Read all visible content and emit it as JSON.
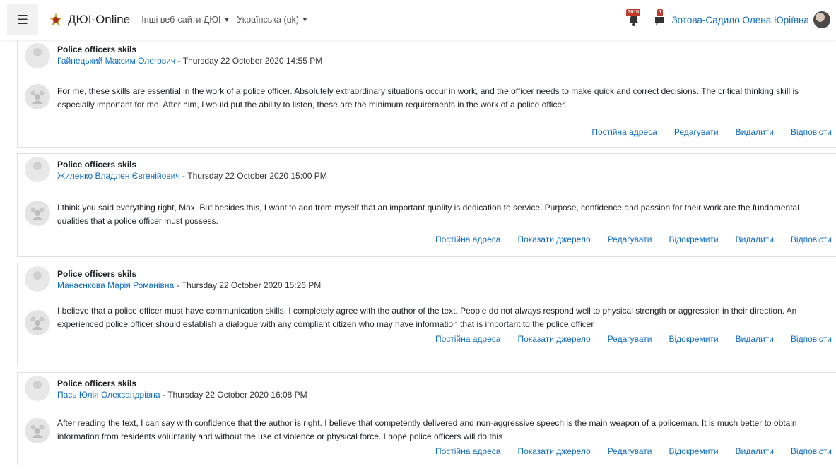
{
  "navbar": {
    "brand": "ДЮІ-Online",
    "menu": [
      {
        "label": "Інші веб-сайти ДЮІ"
      },
      {
        "label": "Українська (uk)"
      }
    ],
    "notifications_count": "3010",
    "messages_count": "1",
    "user_name": "Зотова-Садило Олена Юріївна"
  },
  "colors": {
    "link": "#0f6cbf",
    "badge": "#c0392b"
  },
  "posts": [
    {
      "subject": "Police officers skils",
      "author": "Гайнецький Максим Олегович",
      "date": " - Thursday 22 October 2020 14:55 PM",
      "body": "For me, these skills are essential in the work of a police officer. Absolutely extraordinary situations occur in work, and the officer needs to make quick and correct decisions. The critical thinking skill is especially important for me. After him, I would put the ability to listen, these are the minimum requirements in the work of a police officer.",
      "actions": [
        "Постійна адреса",
        "Редагувати",
        "Видалити",
        "Відповісти"
      ]
    },
    {
      "subject": "Police officers skils",
      "author": "Жиленко Владлен Євгенійович",
      "date": " - Thursday 22 October 2020 15:00 PM",
      "body": "I think you said everything right, Max. But besides this, I want to add from myself that an important quality is dedication to service. Purpose, confidence and passion for their work are the fundamental qualities that a police officer must possess.",
      "actions": [
        "Постійна адреса",
        "Показати джерело",
        "Редагувати",
        "Відокремити",
        "Видалити",
        "Відповісти"
      ]
    },
    {
      "subject": "Police officers skils",
      "author": "Манаєнкова Марія Романівна",
      "date": " - Thursday 22 October 2020 15:26 PM",
      "body": "I believe that a police officer must have communication skills. I completely agree with the author of the text. People do not always respond well to physical strength or aggression in their direction. An experienced police officer should establish a dialogue with any compliant citizen who may have information that is important to the police officer",
      "actions": [
        "Постійна адреса",
        "Показати джерело",
        "Редагувати",
        "Відокремити",
        "Видалити",
        "Відповісти"
      ]
    },
    {
      "subject": "Police officers skils",
      "author": "Пась Юлія Олександрівна",
      "date": " - Thursday 22 October 2020 16:08 PM",
      "body": "After reading the text, I can say with confidence that the author is right. I believe that competently delivered and non-aggressive speech is the main weapon of a policeman. It is much better to obtain information from residents voluntarily and without the use of violence or physical force. I hope police officers will do this",
      "actions": [
        "Постійна адреса",
        "Показати джерело",
        "Редагувати",
        "Відокремити",
        "Видалити",
        "Відповісти"
      ]
    }
  ]
}
